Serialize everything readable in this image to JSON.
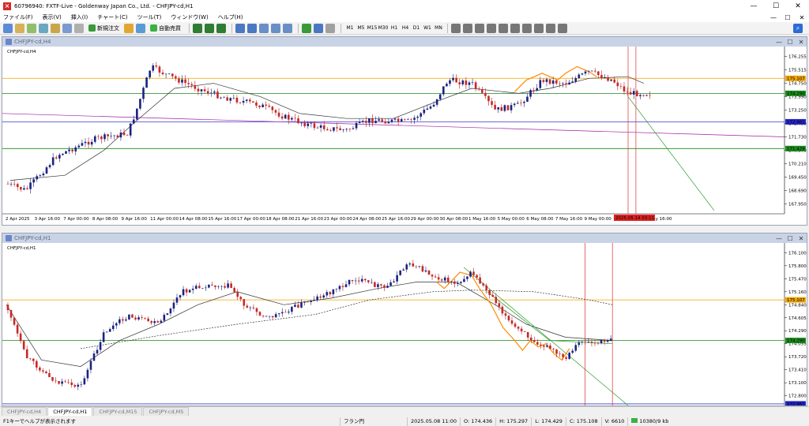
{
  "window": {
    "title": "60796940: FXTF-Live - Goldenway Japan Co., Ltd. - CHFJPY-cd,H1",
    "minimize": "—",
    "maximize": "☐",
    "close": "✕"
  },
  "menu": [
    "ファイル(F)",
    "表示(V)",
    "挿入(I)",
    "チャート(C)",
    "ツール(T)",
    "ウィンドウ(W)",
    "ヘルプ(H)"
  ],
  "toolbar": {
    "new_order": "新規注文",
    "auto_trade": "自動売買",
    "timeframes": [
      "M1",
      "M5",
      "M15",
      "M30",
      "H1",
      "H4",
      "D1",
      "W1",
      "MN"
    ]
  },
  "charts": [
    {
      "id": "h4",
      "window_title": "CHFJPY-cd,H4",
      "label": "CHFJPY-cd,H4",
      "price_labels": [
        "176.255",
        "175.515",
        "174.750",
        "173.990",
        "173.250",
        "172.490",
        "171.730",
        "170.970",
        "170.210",
        "169.450",
        "168.690",
        "167.950"
      ],
      "markers": [
        {
          "text": "175.107",
          "color": "#f2a500"
        },
        {
          "text": "174.290",
          "color": "#1a8a1a"
        },
        {
          "text": "172.961",
          "color": "#2424c8"
        },
        {
          "text": "171.429",
          "color": "#1a8a1a"
        }
      ],
      "time_labels": [
        "2 Apr 2025",
        "3 Apr 16:00",
        "7 Apr 00:00",
        "8 Apr 08:00",
        "9 Apr 16:00",
        "11 Apr 00:00",
        "14 Apr 08:00",
        "15 Apr 16:00",
        "17 Apr 00:00",
        "18 Apr 08:00",
        "21 Apr 16:00",
        "23 Apr 00:00",
        "24 Apr 08:00",
        "25 Apr 16:00",
        "29 Apr 00:00",
        "30 Apr 08:00",
        "1 May 16:00",
        "5 May 00:00",
        "6 May 08:00",
        "7 May 16:00",
        "9 May 00:00",
        "12 May 08:00",
        "13 May 16:00"
      ],
      "time_marker": "2025.05.14 03:11"
    },
    {
      "id": "h1",
      "window_title": "CHFJPY-cd,H1",
      "label": "CHFJPY-cd,H1",
      "price_labels": [
        "176.100",
        "175.800",
        "175.470",
        "175.160",
        "174.840",
        "174.605",
        "174.290",
        "174.055",
        "173.720",
        "173.410",
        "173.100",
        "172.800"
      ],
      "markers": [
        {
          "text": "175.107",
          "color": "#f2a500"
        },
        {
          "text": "174.290",
          "color": "#1a8a1a"
        },
        {
          "text": "172.961",
          "color": "#2424c8"
        }
      ]
    }
  ],
  "tabs": [
    "CHFJPY-cd,H4",
    "CHFJPY-cd,H1",
    "CHFJPY-cd,M15",
    "CHFJPY-cd,M5"
  ],
  "status": {
    "help": "F1キーでヘルプが表示されます",
    "profile": "フラン円",
    "datetime": "2025.05.08 11:00",
    "open": "O: 174.436",
    "high": "H: 175.297",
    "low": "L: 174.429",
    "close": "C: 175.108",
    "volume": "V: 6610",
    "traffic": "10380/9 kb"
  }
}
